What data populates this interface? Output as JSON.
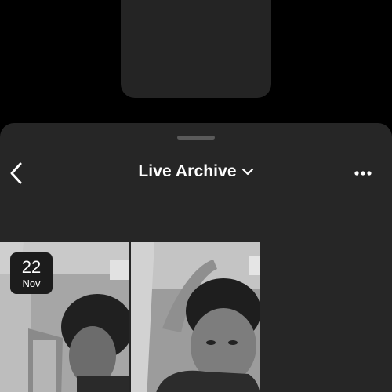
{
  "header": {
    "title": "Live Archive",
    "back_icon": "chevron-left-icon",
    "title_dropdown_icon": "chevron-down-icon",
    "more_icon": "more-horizontal-icon"
  },
  "archive": {
    "items": [
      {
        "day": "22",
        "month": "Nov",
        "thumbnail": "grayscale selfie of man in beanie, head turned"
      },
      {
        "thumbnail": "grayscale selfie of man in beanie, hand on head"
      }
    ]
  },
  "colors": {
    "background": "#000000",
    "sheet": "#262626",
    "text": "#ffffff",
    "badge": "#1c1c1c"
  }
}
